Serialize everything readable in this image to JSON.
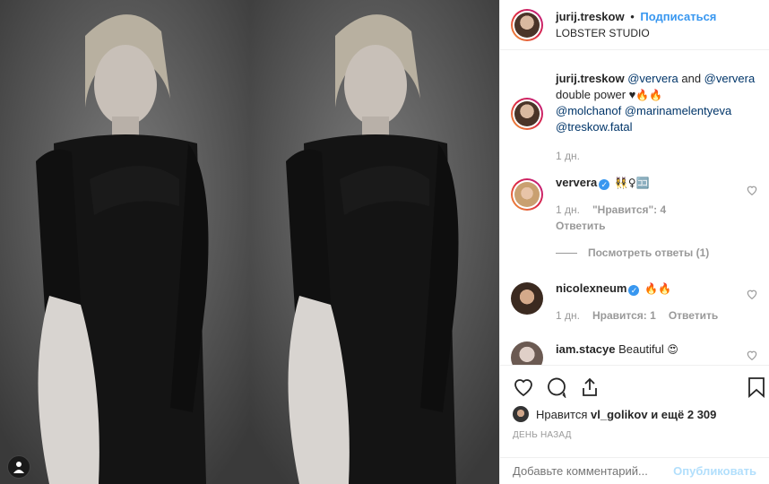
{
  "post": {
    "author": "jurij.treskow",
    "separator": "•",
    "follow_label": "Подписаться",
    "location": "LOBSTER STUDIO"
  },
  "caption": {
    "author": "jurij.treskow",
    "m1": "@ververa",
    "and": " and ",
    "m2": "@ververa",
    "line2": "double power ♥",
    "emoji": "🔥🔥",
    "m3": "@molchanof",
    "m4": "@marinamelentyeva",
    "m5": "@treskow.fatal",
    "time": "1 дн."
  },
  "comments": [
    {
      "user": "ververa",
      "emoji": "👯‍♀️♀🈁",
      "time": "1 дн.",
      "likes": "\"Нравится\": 4",
      "reply": "Ответить"
    },
    {
      "user": "nicolexneum",
      "emoji": "🔥🔥",
      "time": "1 дн.",
      "likes": "Нравится: 1",
      "reply": "Ответить"
    },
    {
      "user": "iam.stacye",
      "text": "Beautiful",
      "emoji": "😍"
    }
  ],
  "view_replies": "Посмотреть ответы (1)",
  "likes": {
    "prefix": "Нравится",
    "user": "vl_golikov",
    "suffix": "и ещё 2 309"
  },
  "date": "ДЕНЬ НАЗАД",
  "add_comment": {
    "placeholder": "Добавьте комментарий...",
    "publish": "Опубликовать"
  },
  "colors": {
    "accent": "#3897f0",
    "publish_disabled": "#b2dffc",
    "muted": "#999999"
  }
}
